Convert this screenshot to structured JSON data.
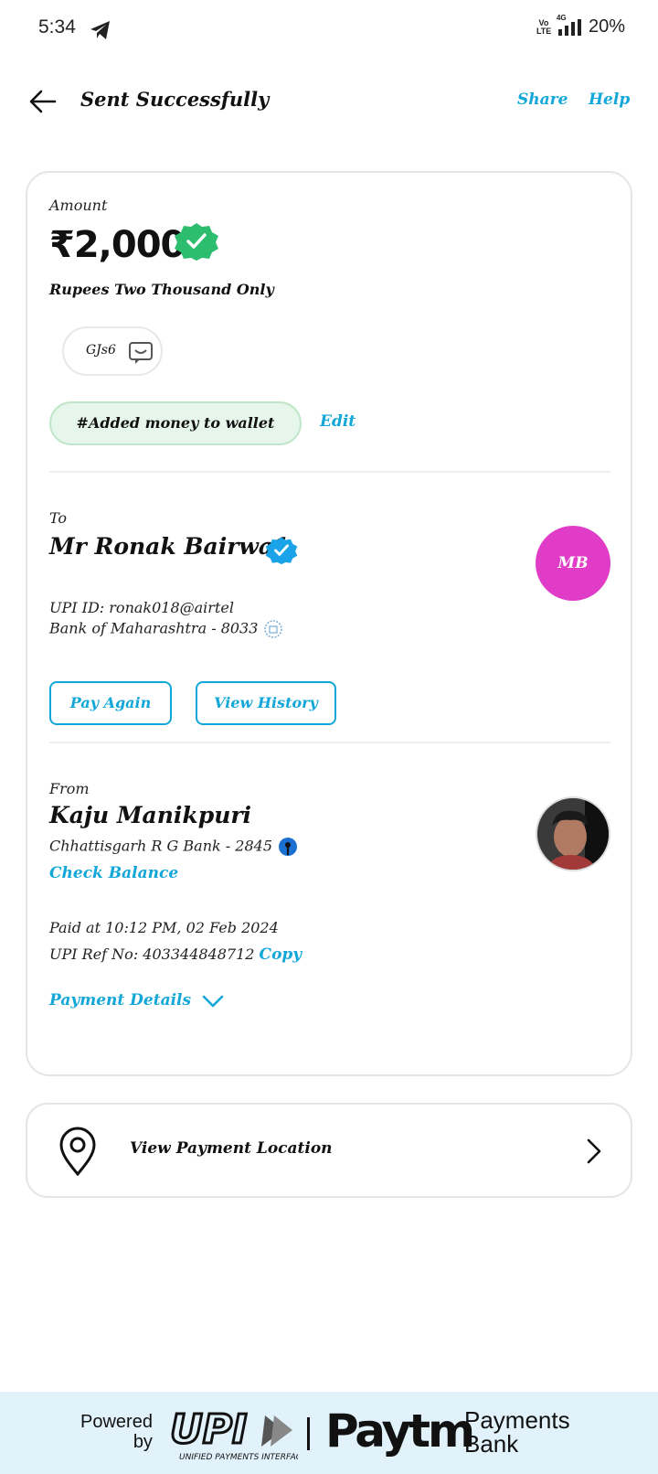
{
  "status_bar": {
    "time": "5:34",
    "network": "4G",
    "volte": "Vo LTE",
    "battery": "20%"
  },
  "header": {
    "title": "Sent Successfully",
    "share": "Share",
    "help": "Help"
  },
  "amount_section": {
    "label": "Amount",
    "amount": "₹2,000",
    "amount_words": "Rupees Two Thousand Only",
    "message": "GJs6",
    "tag": "#Added money to wallet",
    "edit": "Edit"
  },
  "to_section": {
    "label": "To",
    "name": "Mr Ronak Bairwa1",
    "initials": "MB",
    "upi_id": "UPI ID: ronak018@airtel",
    "bank": "Bank of Maharashtra - 8033",
    "pay_again": "Pay Again",
    "view_history": "View History"
  },
  "from_section": {
    "label": "From",
    "name": "Kaju Manikpuri",
    "bank": "Chhattisgarh R G Bank - 2845",
    "check_balance": "Check Balance",
    "paid_at": "Paid at 10:12 PM, 02 Feb 2024",
    "ref_no": "UPI Ref No: 403344848712",
    "copy": "Copy",
    "payment_details": "Payment Details"
  },
  "location": {
    "label": "View Payment Location"
  },
  "footer": {
    "powered_1": "Powered",
    "powered_2": "by",
    "upi_sub": "UNIFIED PAYMENTS INTERFACE",
    "paytm": "Paytm",
    "payments": "Payments",
    "bank": "Bank"
  },
  "colors": {
    "accent": "#12a7d8",
    "success": "#2dbd6e",
    "avatar": "#e03cc7"
  }
}
